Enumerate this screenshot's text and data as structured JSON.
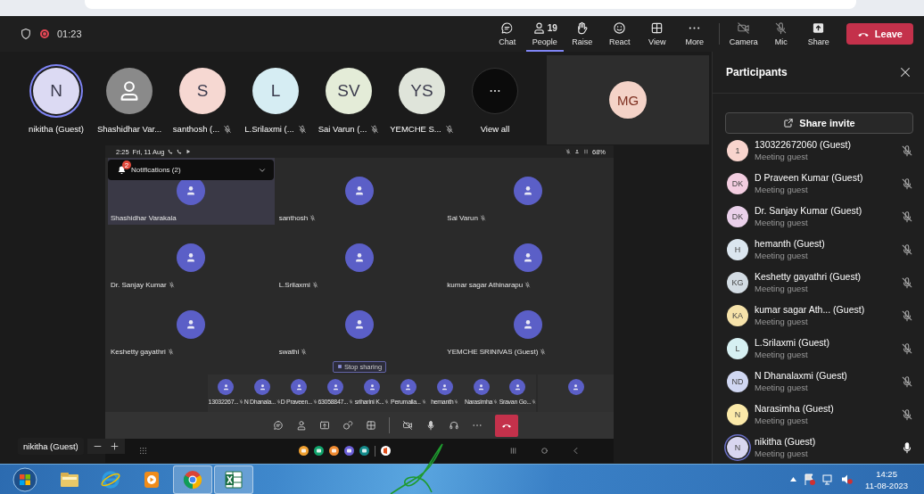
{
  "top_bar": {
    "recording": true,
    "timer": "01:23",
    "actions": [
      {
        "kind": "chat",
        "label": "Chat",
        "selected": false
      },
      {
        "kind": "people",
        "label": "People",
        "count": "19",
        "selected": true
      },
      {
        "kind": "hand",
        "label": "Raise",
        "selected": false
      },
      {
        "kind": "smile",
        "label": "React",
        "selected": false
      },
      {
        "kind": "grid",
        "label": "View",
        "selected": false
      },
      {
        "kind": "dots",
        "label": "More",
        "selected": false
      }
    ],
    "devices": [
      {
        "kind": "camoff",
        "label": "Camera",
        "disabled": true
      },
      {
        "kind": "micoff",
        "label": "Mic",
        "disabled": true
      },
      {
        "kind": "share",
        "label": "Share",
        "disabled": false
      }
    ],
    "leave": "Leave"
  },
  "gallery": {
    "participants": [
      {
        "kind": "initials",
        "initials": "N",
        "name": "nikitha (Guest)",
        "color": "#dcdaf3",
        "highlighted": true,
        "muted": false
      },
      {
        "kind": "icon",
        "name": "Shashidhar Var...",
        "color": "#8a8a8a",
        "highlighted": false,
        "muted": false
      },
      {
        "kind": "initials",
        "initials": "S",
        "name": "santhosh (...",
        "color": "#f6d8d2",
        "highlighted": false,
        "muted": true
      },
      {
        "kind": "initials",
        "initials": "L",
        "name": "L.Srilaxmi (...",
        "color": "#d6edf3",
        "highlighted": false,
        "muted": true
      },
      {
        "kind": "initials",
        "initials": "SV",
        "name": "Sai Varun (...",
        "color": "#e4ecd8",
        "highlighted": false,
        "muted": true
      },
      {
        "kind": "initials",
        "initials": "YS",
        "name": "YEMCHE S...",
        "color": "#dfe4da",
        "highlighted": false,
        "muted": true
      }
    ],
    "view_all": "View all",
    "spotlight": {
      "initials": "MG",
      "color": "#f4d3c8"
    }
  },
  "shared_screen": {
    "time": "2:25",
    "date": "Fri, 11 Aug",
    "battery": "68%",
    "notification": {
      "badge": "2",
      "text": "Notifications (2)"
    },
    "tiles": [
      {
        "name": "Shashidhar Varakala",
        "muted": false,
        "highlighted": true
      },
      {
        "name": "santhosh",
        "muted": true,
        "highlighted": false
      },
      {
        "name": "Sai Varun",
        "muted": true,
        "highlighted": false
      },
      {
        "name": "Dr. Sanjay Kumar",
        "muted": true,
        "highlighted": false
      },
      {
        "name": "L.Srilaxmi",
        "muted": true,
        "highlighted": false
      },
      {
        "name": "kumar sagar Athinarapu",
        "muted": true,
        "highlighted": false
      },
      {
        "name": "Keshetty gayathri",
        "muted": true,
        "highlighted": false
      },
      {
        "name": "swathi",
        "muted": true,
        "highlighted": false
      },
      {
        "name": "YEMCHE SRINIVAS (Guest)",
        "muted": true,
        "highlighted": false
      }
    ],
    "stop_sharing": "Stop sharing",
    "strip": [
      {
        "kind": "named",
        "name": "13032267...",
        "muted": true
      },
      {
        "kind": "named",
        "name": "N Dhanala...",
        "muted": true
      },
      {
        "kind": "named",
        "name": "D Praveen...",
        "muted": true
      },
      {
        "kind": "named",
        "name": "63058847...",
        "muted": true
      },
      {
        "kind": "named",
        "name": "sriharini K...",
        "muted": true
      },
      {
        "kind": "named",
        "name": "Perumalla...",
        "muted": true
      },
      {
        "kind": "named",
        "name": "hemanth",
        "muted": true
      },
      {
        "kind": "named",
        "name": "Narasimha",
        "muted": true
      },
      {
        "kind": "named",
        "name": "Sravan Go...",
        "muted": true
      },
      {
        "kind": "avatar_only"
      }
    ]
  },
  "self_view": {
    "name": "nikitha (Guest)"
  },
  "participants_panel": {
    "title": "Participants",
    "share_invite": "Share invite",
    "people": [
      {
        "initials": "1",
        "name": "130322672060 (Guest)",
        "role": "Meeting guest",
        "color": "#f8d4cd",
        "muted": true,
        "highlighted": false
      },
      {
        "initials": "DK",
        "name": "D Praveen Kumar (Guest)",
        "role": "Meeting guest",
        "color": "#f3cde0",
        "muted": true,
        "highlighted": false
      },
      {
        "initials": "DK",
        "name": "Dr. Sanjay Kumar (Guest)",
        "role": "Meeting guest",
        "color": "#ead0ea",
        "muted": true,
        "highlighted": false
      },
      {
        "initials": "H",
        "name": "hemanth (Guest)",
        "role": "Meeting guest",
        "color": "#dbe6ef",
        "muted": true,
        "highlighted": false
      },
      {
        "initials": "KG",
        "name": "Keshetty gayathri (Guest)",
        "role": "Meeting guest",
        "color": "#d3dce3",
        "muted": true,
        "highlighted": false
      },
      {
        "initials": "KA",
        "name": "kumar sagar Ath... (Guest)",
        "role": "Meeting guest",
        "color": "#f6e2a9",
        "muted": true,
        "highlighted": false
      },
      {
        "initials": "L",
        "name": "L.Srilaxmi (Guest)",
        "role": "Meeting guest",
        "color": "#d6f0f2",
        "muted": true,
        "highlighted": false
      },
      {
        "initials": "ND",
        "name": "N Dhanalaxmi (Guest)",
        "role": "Meeting guest",
        "color": "#d0d7f2",
        "muted": true,
        "highlighted": false
      },
      {
        "initials": "N",
        "name": "Narasimha (Guest)",
        "role": "Meeting guest",
        "color": "#fbe9a8",
        "muted": true,
        "highlighted": false
      },
      {
        "initials": "N",
        "name": "nikitha (Guest)",
        "role": "Meeting guest",
        "color": "#d9d6f0",
        "muted": false,
        "highlighted": true
      }
    ]
  },
  "taskbar": {
    "apps": [
      {
        "kind": "folder",
        "running": false
      },
      {
        "kind": "ie",
        "running": false
      },
      {
        "kind": "media",
        "running": false
      },
      {
        "kind": "chrome",
        "running": true
      },
      {
        "kind": "excel",
        "running": true
      }
    ],
    "time": "14:25",
    "date": "11-08-2023"
  }
}
